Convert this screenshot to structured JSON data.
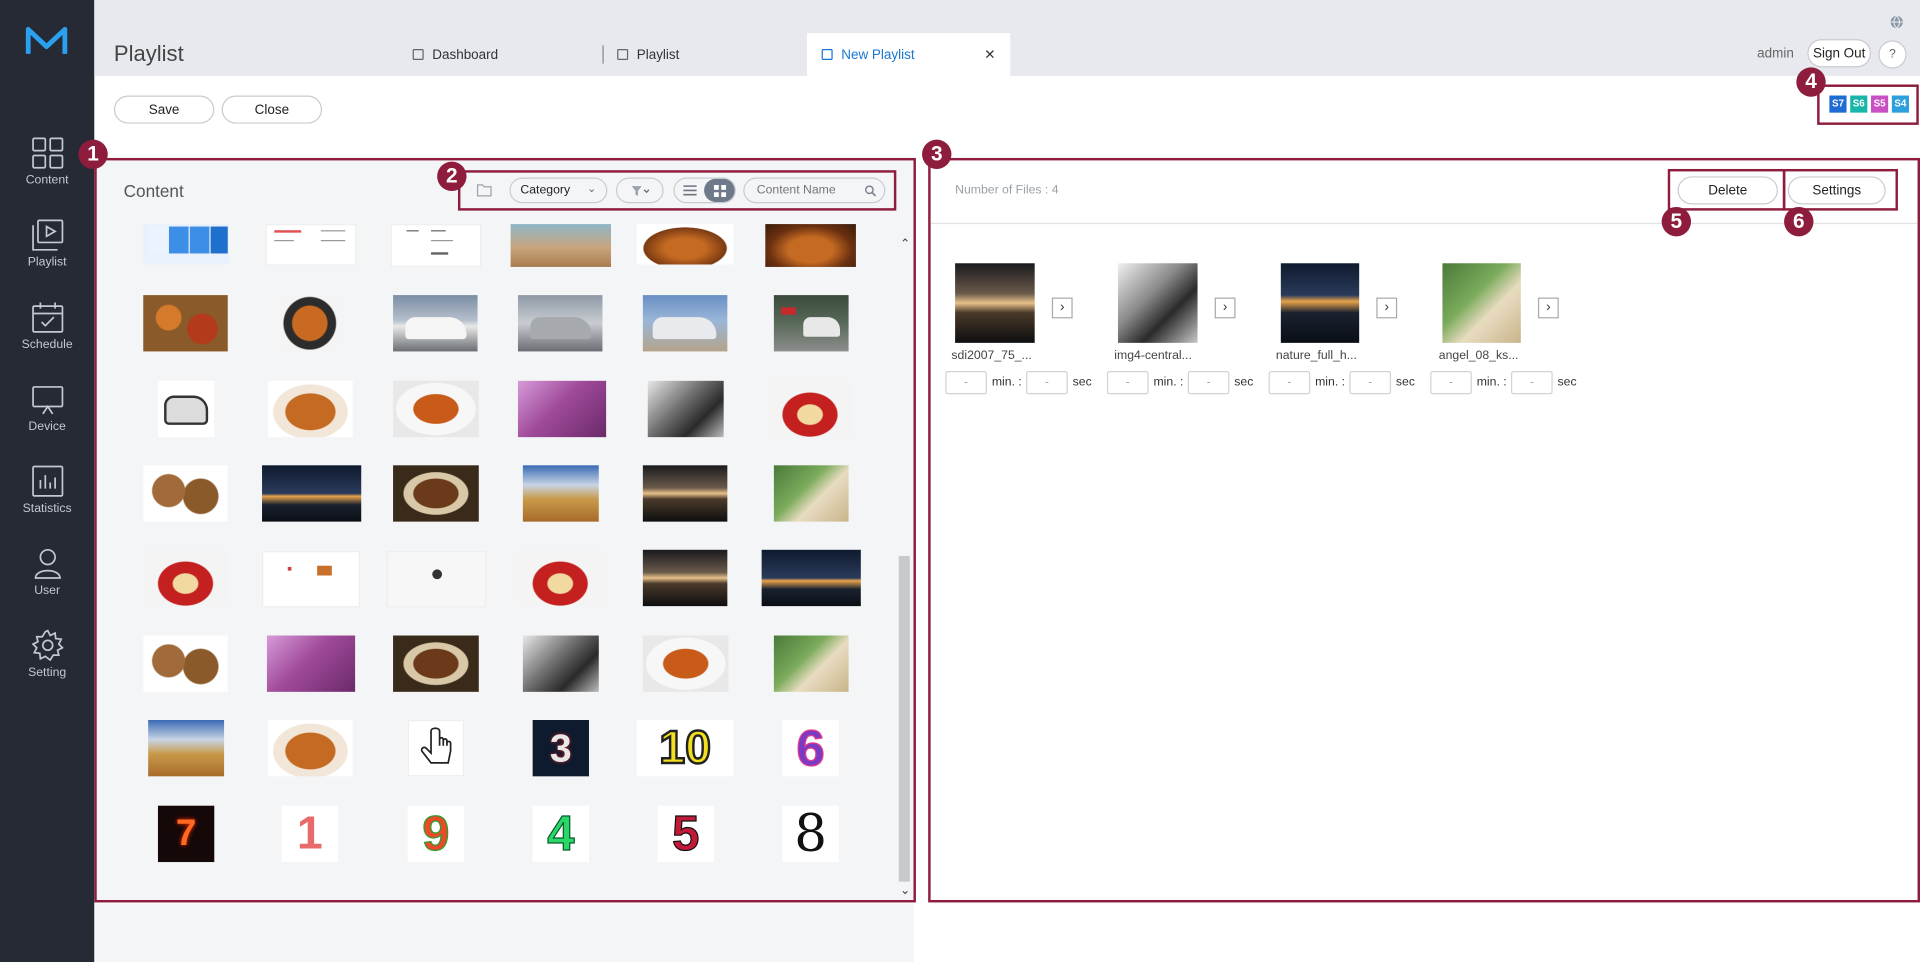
{
  "app": {
    "title": "Playlist"
  },
  "nav": [
    {
      "label": "Content",
      "icon": "grid-icon"
    },
    {
      "label": "Playlist",
      "icon": "playlist-icon"
    },
    {
      "label": "Schedule",
      "icon": "calendar-icon"
    },
    {
      "label": "Device",
      "icon": "monitor-icon"
    },
    {
      "label": "Statistics",
      "icon": "chart-icon"
    },
    {
      "label": "User",
      "icon": "user-icon"
    },
    {
      "label": "Setting",
      "icon": "gear-icon"
    }
  ],
  "tabs": {
    "dashboard": "Dashboard",
    "playlist": "Playlist",
    "new_playlist": "New Playlist",
    "close_glyph": "✕"
  },
  "user": {
    "name": "admin",
    "sign_out": "Sign Out",
    "help": "?"
  },
  "toolbar": {
    "save": "Save",
    "close": "Close"
  },
  "device_types": [
    "S7",
    "S6",
    "S5",
    "S4"
  ],
  "colors": {
    "accent": "#1976d2",
    "annotation": "#8e1d3d",
    "sidebar": "#252a35",
    "s7": "#1e6bd6",
    "s6": "#18b6a8",
    "s5": "#c84fc4",
    "s4": "#2d9fdc"
  },
  "content_panel": {
    "title": "Content",
    "category_label": "Category",
    "search_placeholder": "Content Name"
  },
  "playlist_panel": {
    "file_count": "Number of Files : 4",
    "delete": "Delete",
    "settings": "Settings",
    "items": [
      {
        "name": "sdi2007_75_...",
        "min": "-",
        "sec": "-"
      },
      {
        "name": "img4-central...",
        "min": "-",
        "sec": "-"
      },
      {
        "name": "nature_full_h...",
        "min": "-",
        "sec": "-"
      },
      {
        "name": "angel_08_ks...",
        "min": "-",
        "sec": "-"
      }
    ],
    "min_label": "min. :",
    "sec_label": "sec"
  },
  "annotations": [
    "1",
    "2",
    "3",
    "4",
    "5",
    "6"
  ],
  "thumbnail_texts": {
    "number_3": "3",
    "number_10": "10",
    "number_6": "6",
    "number_7": "7",
    "number_1": "1",
    "number_9": "9",
    "number_4": "4",
    "number_5": "5",
    "number_8": "8"
  }
}
